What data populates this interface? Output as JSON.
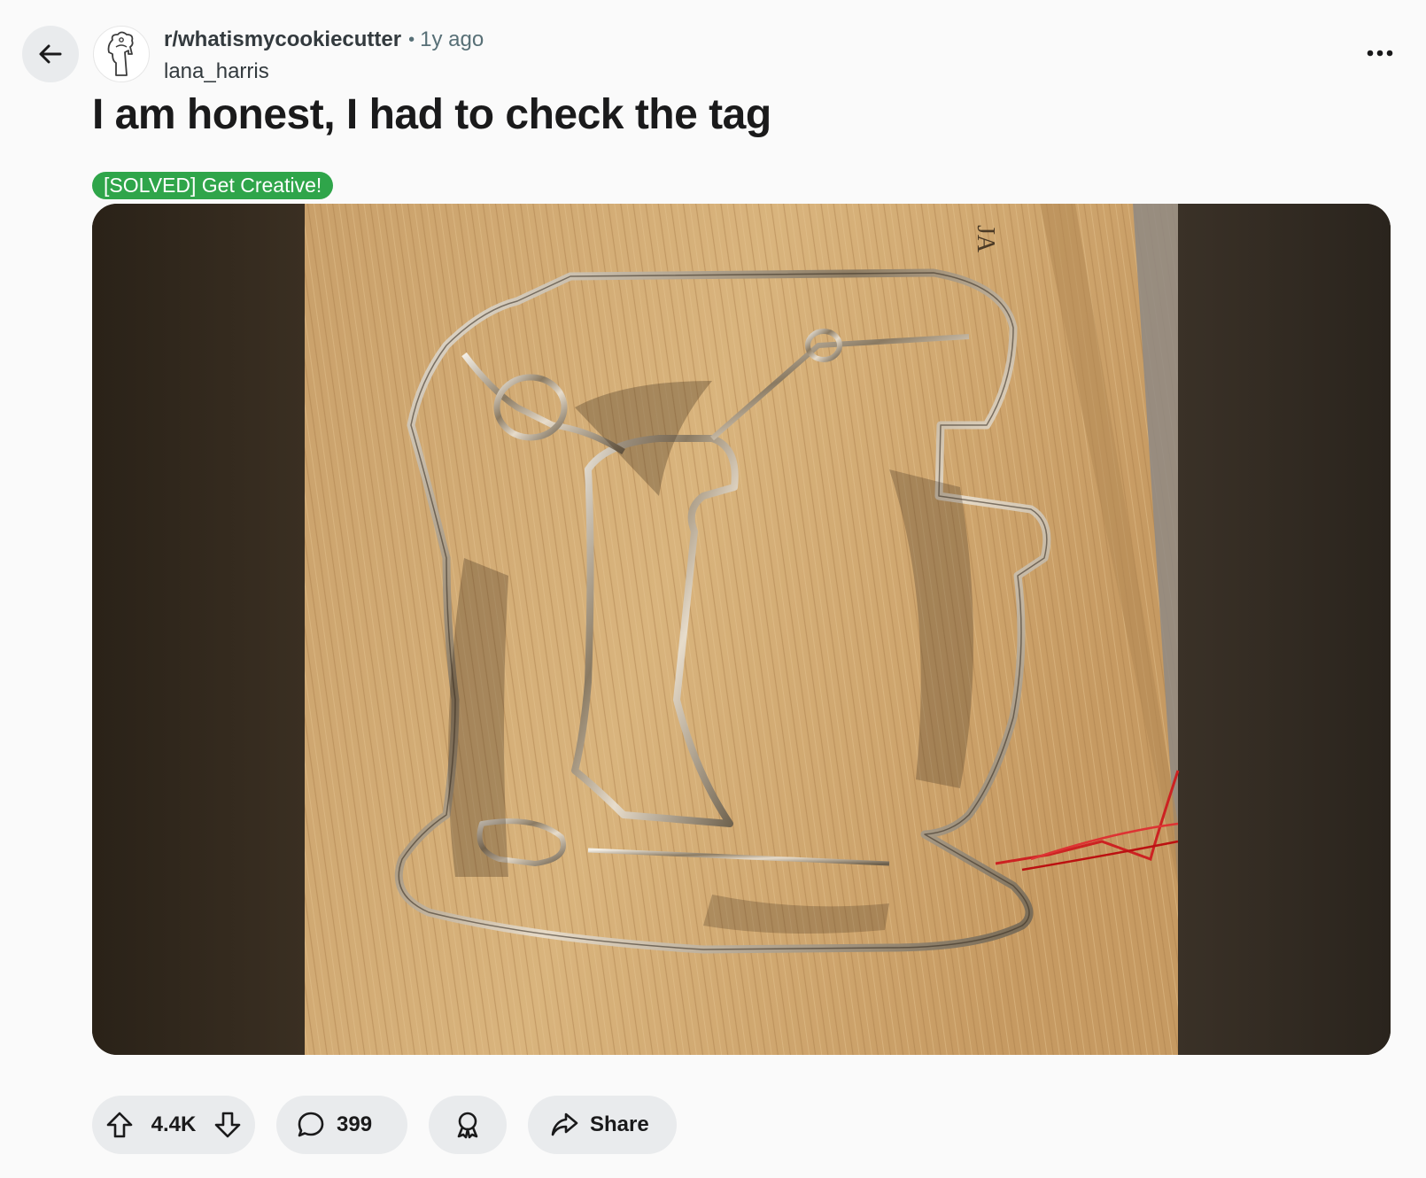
{
  "post": {
    "subreddit": "r/whatismycookiecutter",
    "separator": "•",
    "age": "1y ago",
    "author": "lana_harris",
    "title": "I am honest, I had to check the tag",
    "flair": "[SOLVED] Get Creative!",
    "media_alt": "Stainless steel cookie cutter shaped like a stand mixer on a wooden cutting board"
  },
  "actions": {
    "vote_count": "4.4K",
    "comment_count": "399",
    "share_label": "Share"
  },
  "colors": {
    "flair_bg": "#2fa54a",
    "pill_bg": "#e9ebed",
    "page_bg": "#fafafa"
  },
  "icons": [
    "back-arrow-icon",
    "subreddit-avatar-icon",
    "more-options-icon",
    "upvote-icon",
    "downvote-icon",
    "comment-icon",
    "award-icon",
    "share-icon"
  ]
}
